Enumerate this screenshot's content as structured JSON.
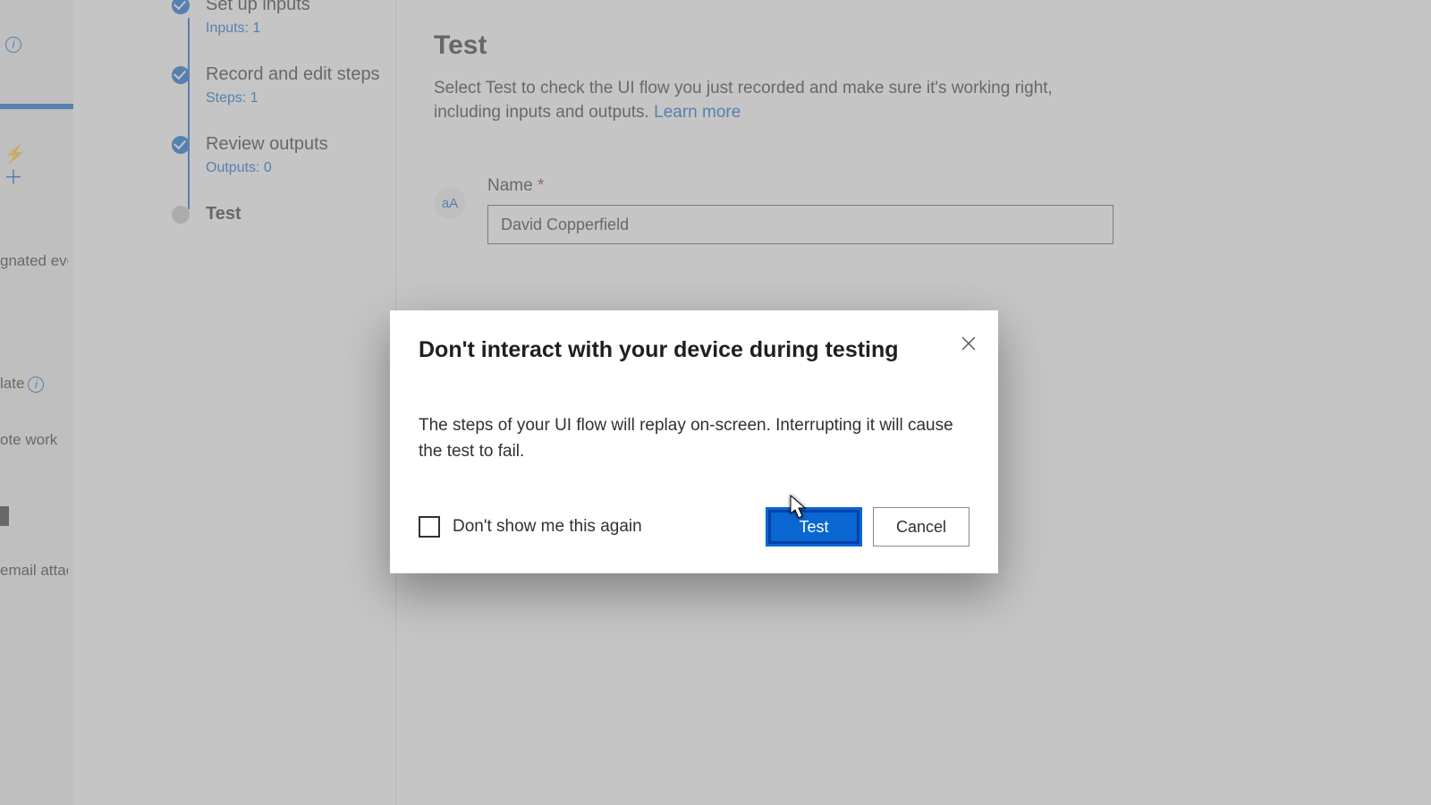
{
  "leftcol": {
    "text1": "gnated even",
    "text2": "late",
    "text3": "ote work",
    "text4_suffix": "",
    "text5": "email attac"
  },
  "steps": {
    "s1": {
      "title": "Set up inputs",
      "sub": "Inputs: 1"
    },
    "s2": {
      "title": "Record and edit steps",
      "sub": "Steps: 1"
    },
    "s3": {
      "title": "Review outputs",
      "sub": "Outputs: 0"
    },
    "s4": {
      "title": "Test"
    }
  },
  "main": {
    "title": "Test",
    "subtext": "Select Test to check the UI flow you just recorded and make sure it's working right, including inputs and outputs. ",
    "learn_more": "Learn more",
    "name_label": "Name",
    "name_value": "David Copperfield",
    "badge": "aA"
  },
  "modal": {
    "title": "Don't interact with your device during testing",
    "body": "The steps of your UI flow will replay on-screen. Interrupting it will cause the test to fail.",
    "checkbox_label": "Don't show me this again",
    "primary": "Test",
    "cancel": "Cancel"
  }
}
